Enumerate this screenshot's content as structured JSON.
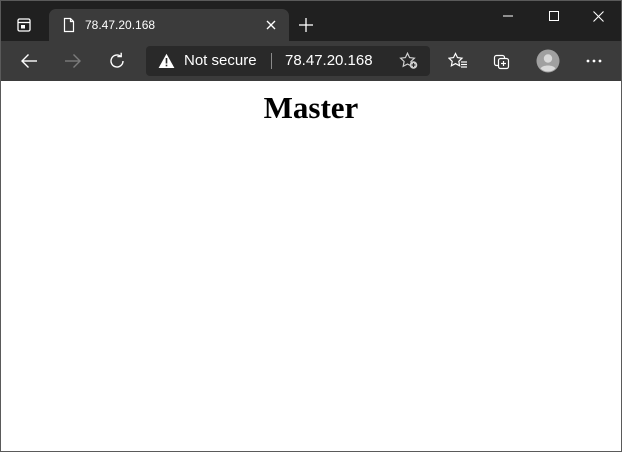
{
  "browser": {
    "tab": {
      "title": "78.47.20.168"
    },
    "address_bar": {
      "security_label": "Not secure",
      "url": "78.47.20.168"
    },
    "icons": {
      "tab_actions": "tab-actions-icon",
      "favicon": "page-icon",
      "tab_close": "close-icon",
      "new_tab": "plus-icon",
      "minimize": "minimize-icon",
      "maximize": "maximize-icon",
      "close_window": "close-icon",
      "back": "back-arrow-icon",
      "forward": "forward-arrow-icon",
      "refresh": "refresh-icon",
      "warning": "warning-icon",
      "add_favorite": "star-add-icon",
      "favorites": "favorites-icon",
      "collections": "collections-icon",
      "profile": "profile-avatar-icon",
      "more": "more-icon"
    },
    "colors": {
      "tabstrip_bg": "#202020",
      "active_tab_bg": "#3b3b3b",
      "toolbar_bg": "#3b3b3b",
      "addressbar_bg": "#292929",
      "content_bg": "#ffffff"
    }
  },
  "page": {
    "heading": "Master"
  }
}
